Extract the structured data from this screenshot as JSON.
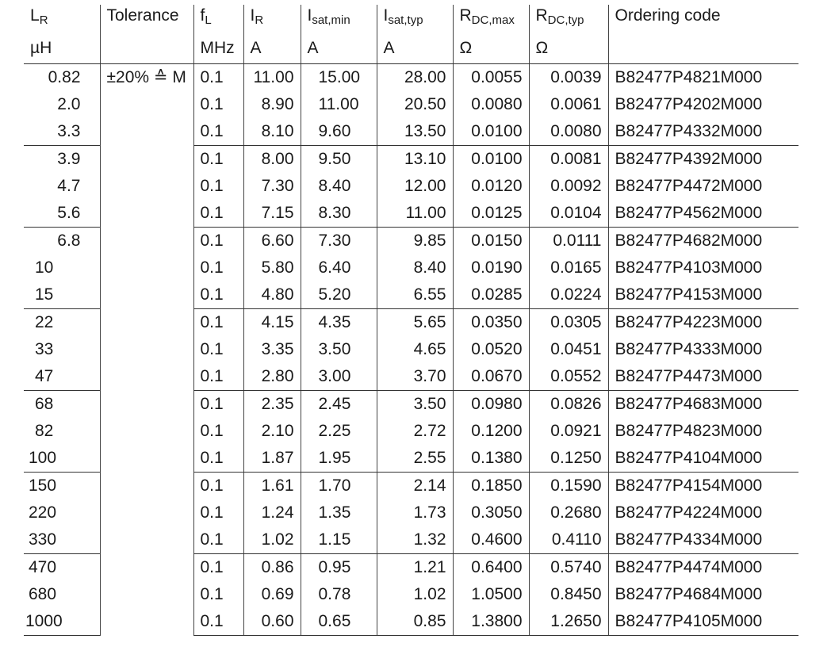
{
  "headers": [
    {
      "base": "L",
      "sub": "R",
      "unit": "µH"
    },
    {
      "base": "Tolerance",
      "sub": "",
      "unit": ""
    },
    {
      "base": "f",
      "sub": "L",
      "unit": "MHz"
    },
    {
      "base": "I",
      "sub": "R",
      "unit": "A"
    },
    {
      "base": "I",
      "sub": "sat,min",
      "unit": "A"
    },
    {
      "base": "I",
      "sub": "sat,typ",
      "unit": "A"
    },
    {
      "base": "R",
      "sub": "DC,max",
      "unit": "Ω"
    },
    {
      "base": "R",
      "sub": "DC,typ",
      "unit": "Ω"
    },
    {
      "base": "Ordering code",
      "sub": "",
      "unit": ""
    }
  ],
  "tolerance": "±20% ≙ M",
  "groups": [
    [
      [
        "0.82",
        "0.1",
        "11.00",
        "15.00",
        "28.00",
        "0.0055",
        "0.0039",
        "B82477P4821M000"
      ],
      [
        "2.0",
        "0.1",
        "8.90",
        "11.00",
        "20.50",
        "0.0080",
        "0.0061",
        "B82477P4202M000"
      ],
      [
        "3.3",
        "0.1",
        "8.10",
        "9.60",
        "13.50",
        "0.0100",
        "0.0080",
        "B82477P4332M000"
      ]
    ],
    [
      [
        "3.9",
        "0.1",
        "8.00",
        "9.50",
        "13.10",
        "0.0100",
        "0.0081",
        "B82477P4392M000"
      ],
      [
        "4.7",
        "0.1",
        "7.30",
        "8.40",
        "12.00",
        "0.0120",
        "0.0092",
        "B82477P4472M000"
      ],
      [
        "5.6",
        "0.1",
        "7.15",
        "8.30",
        "11.00",
        "0.0125",
        "0.0104",
        "B82477P4562M000"
      ]
    ],
    [
      [
        "6.8",
        "0.1",
        "6.60",
        "7.30",
        "9.85",
        "0.0150",
        "0.0111",
        "B82477P4682M000"
      ],
      [
        "10",
        "0.1",
        "5.80",
        "6.40",
        "8.40",
        "0.0190",
        "0.0165",
        "B82477P4103M000"
      ],
      [
        "15",
        "0.1",
        "4.80",
        "5.20",
        "6.55",
        "0.0285",
        "0.0224",
        "B82477P4153M000"
      ]
    ],
    [
      [
        "22",
        "0.1",
        "4.15",
        "4.35",
        "5.65",
        "0.0350",
        "0.0305",
        "B82477P4223M000"
      ],
      [
        "33",
        "0.1",
        "3.35",
        "3.50",
        "4.65",
        "0.0520",
        "0.0451",
        "B82477P4333M000"
      ],
      [
        "47",
        "0.1",
        "2.80",
        "3.00",
        "3.70",
        "0.0670",
        "0.0552",
        "B82477P4473M000"
      ]
    ],
    [
      [
        "68",
        "0.1",
        "2.35",
        "2.45",
        "3.50",
        "0.0980",
        "0.0826",
        "B82477P4683M000"
      ],
      [
        "82",
        "0.1",
        "2.10",
        "2.25",
        "2.72",
        "0.1200",
        "0.0921",
        "B82477P4823M000"
      ],
      [
        "100",
        "0.1",
        "1.87",
        "1.95",
        "2.55",
        "0.1380",
        "0.1250",
        "B82477P4104M000"
      ]
    ],
    [
      [
        "150",
        "0.1",
        "1.61",
        "1.70",
        "2.14",
        "0.1850",
        "0.1590",
        "B82477P4154M000"
      ],
      [
        "220",
        "0.1",
        "1.24",
        "1.35",
        "1.73",
        "0.3050",
        "0.2680",
        "B82477P4224M000"
      ],
      [
        "330",
        "0.1",
        "1.02",
        "1.15",
        "1.32",
        "0.4600",
        "0.4110",
        "B82477P4334M000"
      ]
    ],
    [
      [
        "470",
        "0.1",
        "0.86",
        "0.95",
        "1.21",
        "0.6400",
        "0.5740",
        "B82477P4474M000"
      ],
      [
        "680",
        "0.1",
        "0.69",
        "0.78",
        "1.02",
        "1.0500",
        "0.8450",
        "B82477P4684M000"
      ],
      [
        "1000",
        "0.1",
        "0.60",
        "0.65",
        "0.85",
        "1.3800",
        "1.2650",
        "B82477P4105M000"
      ]
    ]
  ]
}
